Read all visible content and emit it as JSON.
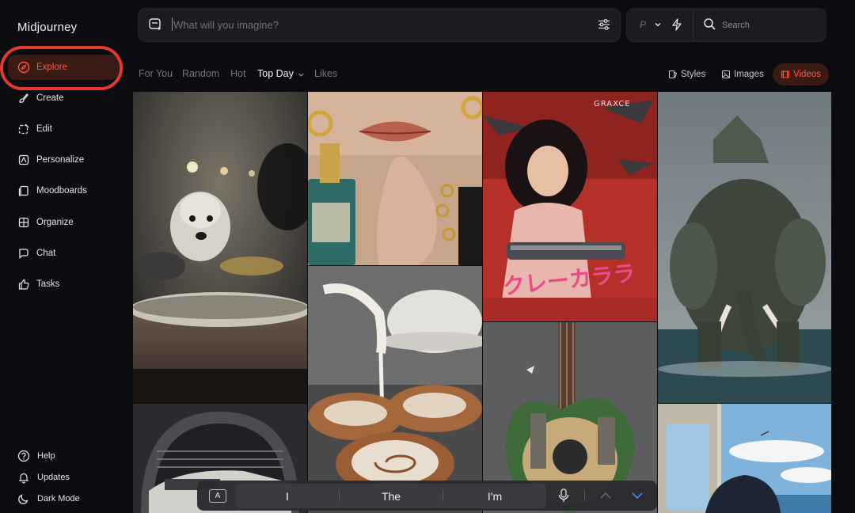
{
  "app": {
    "name": "Midjourney"
  },
  "sidebar": {
    "items": [
      {
        "label": "Explore",
        "icon": "compass-icon",
        "active": true
      },
      {
        "label": "Create",
        "icon": "brush-icon"
      },
      {
        "label": "Edit",
        "icon": "edit-icon"
      },
      {
        "label": "Personalize",
        "icon": "personalize-icon"
      },
      {
        "label": "Moodboards",
        "icon": "moodboard-icon"
      },
      {
        "label": "Organize",
        "icon": "grid-icon"
      },
      {
        "label": "Chat",
        "icon": "chat-icon"
      },
      {
        "label": "Tasks",
        "icon": "thumbs-up-icon"
      }
    ],
    "bottom": [
      {
        "label": "Help",
        "icon": "help-icon"
      },
      {
        "label": "Updates",
        "icon": "bell-icon"
      },
      {
        "label": "Dark Mode",
        "icon": "moon-icon"
      }
    ]
  },
  "prompt": {
    "placeholder": "What will you imagine?"
  },
  "toolbar": {
    "p_label": "P"
  },
  "search": {
    "placeholder": "Search"
  },
  "tabs": [
    {
      "label": "For You"
    },
    {
      "label": "Random"
    },
    {
      "label": "Hot"
    },
    {
      "label": "Top Day",
      "active": true
    },
    {
      "label": "Likes"
    }
  ],
  "view_toggle": [
    {
      "label": "Styles",
      "icon": "styles-icon"
    },
    {
      "label": "Images",
      "icon": "image-icon"
    },
    {
      "label": "Videos",
      "icon": "video-icon",
      "active": true
    }
  ],
  "gallery": {
    "poster_text": {
      "brand": "GRAXCE",
      "title": "クレーカララ"
    }
  },
  "keyboard": {
    "suggestions": [
      "I",
      "The",
      "I'm"
    ],
    "key_label": "A"
  },
  "colors": {
    "accent": "#ff5a3a",
    "highlight_ring": "#e23a2f",
    "background": "#0b0c0f"
  }
}
